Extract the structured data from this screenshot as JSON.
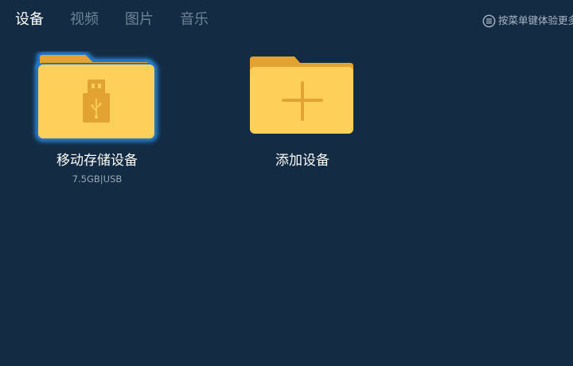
{
  "tabs": [
    {
      "label": "设备",
      "active": true
    },
    {
      "label": "视频",
      "active": false
    },
    {
      "label": "图片",
      "active": false
    },
    {
      "label": "音乐",
      "active": false
    }
  ],
  "menu_hint": {
    "icon": "menu-icon",
    "text": "按菜单键体验更多"
  },
  "devices": [
    {
      "icon": "usb-folder-icon",
      "name": "移动存储设备",
      "info": "7.5GB|USB",
      "focused": true
    },
    {
      "icon": "add-folder-icon",
      "name": "添加设备",
      "focused": false
    }
  ],
  "colors": {
    "background": "#132c44",
    "folder_front": "#fdd05a",
    "folder_back": "#e3a330",
    "focus_glow": "#2f9bff",
    "tab_active": "#ffffff",
    "tab_inactive": "#6f8396"
  }
}
